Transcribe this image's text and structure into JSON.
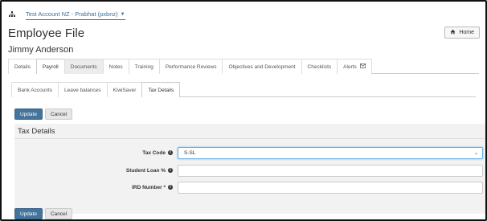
{
  "topbar": {
    "org_icon": "sitemap-icon",
    "account_label": "Test Account NZ - Prabhat (pxbnz)"
  },
  "page": {
    "title": "Employee File",
    "home_label": "Home",
    "employee_name": "Jimmy Anderson"
  },
  "main_tabs": [
    {
      "label": "Details"
    },
    {
      "label": "Payroll"
    },
    {
      "label": "Documents"
    },
    {
      "label": "Notes"
    },
    {
      "label": "Training"
    },
    {
      "label": "Performance Reviews"
    },
    {
      "label": "Objectives and Development"
    },
    {
      "label": "Checklists"
    },
    {
      "label": "Alerts"
    }
  ],
  "sub_tabs": [
    {
      "label": "Bank Accounts"
    },
    {
      "label": "Leave balances"
    },
    {
      "label": "KiwiSaver"
    },
    {
      "label": "Tax Details"
    }
  ],
  "buttons": {
    "update_label": "Update",
    "cancel_label": "Cancel"
  },
  "form": {
    "section_title": "Tax Details",
    "tax_code_label": "Tax Code",
    "tax_code_value": "S-SL",
    "student_loan_label": "Student Loan %",
    "student_loan_value": "",
    "ird_label": "IRD Number *",
    "ird_value": ""
  },
  "colors": {
    "accent": "#44739b",
    "link": "#3a6f9a",
    "form_background": "#f2f2f2"
  }
}
